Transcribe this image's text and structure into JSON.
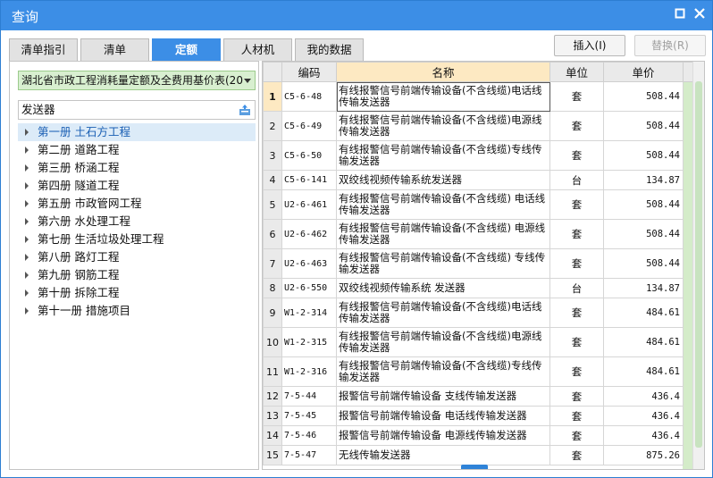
{
  "window": {
    "title": "查询",
    "restore_icon": "restore-icon",
    "close_icon": "close-icon"
  },
  "tabs": [
    {
      "label": "清单指引",
      "active": false
    },
    {
      "label": "清单",
      "active": false
    },
    {
      "label": "定额",
      "active": true
    },
    {
      "label": "人材机",
      "active": false
    },
    {
      "label": "我的数据",
      "active": false
    }
  ],
  "buttons": {
    "insert": "插入(I)",
    "replace": "替换(R)"
  },
  "left": {
    "dropdown_value": "湖北省市政工程消耗量定额及全费用基价表(20",
    "search_value": "发送器",
    "tree": [
      {
        "label": "第一册 土石方工程",
        "selected": true
      },
      {
        "label": "第二册 道路工程",
        "selected": false
      },
      {
        "label": "第三册 桥涵工程",
        "selected": false
      },
      {
        "label": "第四册 隧道工程",
        "selected": false
      },
      {
        "label": "第五册 市政管网工程",
        "selected": false
      },
      {
        "label": "第六册 水处理工程",
        "selected": false
      },
      {
        "label": "第七册 生活垃圾处理工程",
        "selected": false
      },
      {
        "label": "第八册 路灯工程",
        "selected": false
      },
      {
        "label": "第九册 钢筋工程",
        "selected": false
      },
      {
        "label": "第十册 拆除工程",
        "selected": false
      },
      {
        "label": "第十一册 措施项目",
        "selected": false
      }
    ]
  },
  "table": {
    "headers": {
      "num": "",
      "code": "编码",
      "name": "名称",
      "unit": "单位",
      "price": "单价"
    },
    "rows": [
      {
        "n": "1",
        "code": "C5-6-48",
        "name": "有线报警信号前端传输设备(不含线缆)电话线传输发送器",
        "unit": "套",
        "price": "508.44"
      },
      {
        "n": "2",
        "code": "C5-6-49",
        "name": "有线报警信号前端传输设备(不含线缆)电源线传输发送器",
        "unit": "套",
        "price": "508.44"
      },
      {
        "n": "3",
        "code": "C5-6-50",
        "name": "有线报警信号前端传输设备(不含线缆)专线传输发送器",
        "unit": "套",
        "price": "508.44"
      },
      {
        "n": "4",
        "code": "C5-6-141",
        "name": "双绞线视频传输系统发送器",
        "unit": "台",
        "price": "134.87"
      },
      {
        "n": "5",
        "code": "U2-6-461",
        "name": "有线报警信号前端传输设备(不含线缆) 电话线传输发送器",
        "unit": "套",
        "price": "508.44"
      },
      {
        "n": "6",
        "code": "U2-6-462",
        "name": "有线报警信号前端传输设备(不含线缆) 电源线传输发送器",
        "unit": "套",
        "price": "508.44"
      },
      {
        "n": "7",
        "code": "U2-6-463",
        "name": "有线报警信号前端传输设备(不含线缆) 专线传输发送器",
        "unit": "套",
        "price": "508.44"
      },
      {
        "n": "8",
        "code": "U2-6-550",
        "name": "双绞线视频传输系统 发送器",
        "unit": "台",
        "price": "134.87"
      },
      {
        "n": "9",
        "code": "W1-2-314",
        "name": "有线报警信号前端传输设备(不含线缆)电话线传输发送器",
        "unit": "套",
        "price": "484.61"
      },
      {
        "n": "10",
        "code": "W1-2-315",
        "name": "有线报警信号前端传输设备(不含线缆)电源线传输发送器",
        "unit": "套",
        "price": "484.61"
      },
      {
        "n": "11",
        "code": "W1-2-316",
        "name": "有线报警信号前端传输设备(不含线缆)专线传输发送器",
        "unit": "套",
        "price": "484.61"
      },
      {
        "n": "12",
        "code": "7-5-44",
        "name": "报警信号前端传输设备 支线传输发送器",
        "unit": "套",
        "price": "436.4"
      },
      {
        "n": "13",
        "code": "7-5-45",
        "name": "报警信号前端传输设备 电话线传输发送器",
        "unit": "套",
        "price": "436.4"
      },
      {
        "n": "14",
        "code": "7-5-46",
        "name": "报警信号前端传输设备 电源线传输发送器",
        "unit": "套",
        "price": "436.4"
      },
      {
        "n": "15",
        "code": "7-5-47",
        "name": "无线传输发送器",
        "unit": "套",
        "price": "875.26"
      }
    ]
  }
}
